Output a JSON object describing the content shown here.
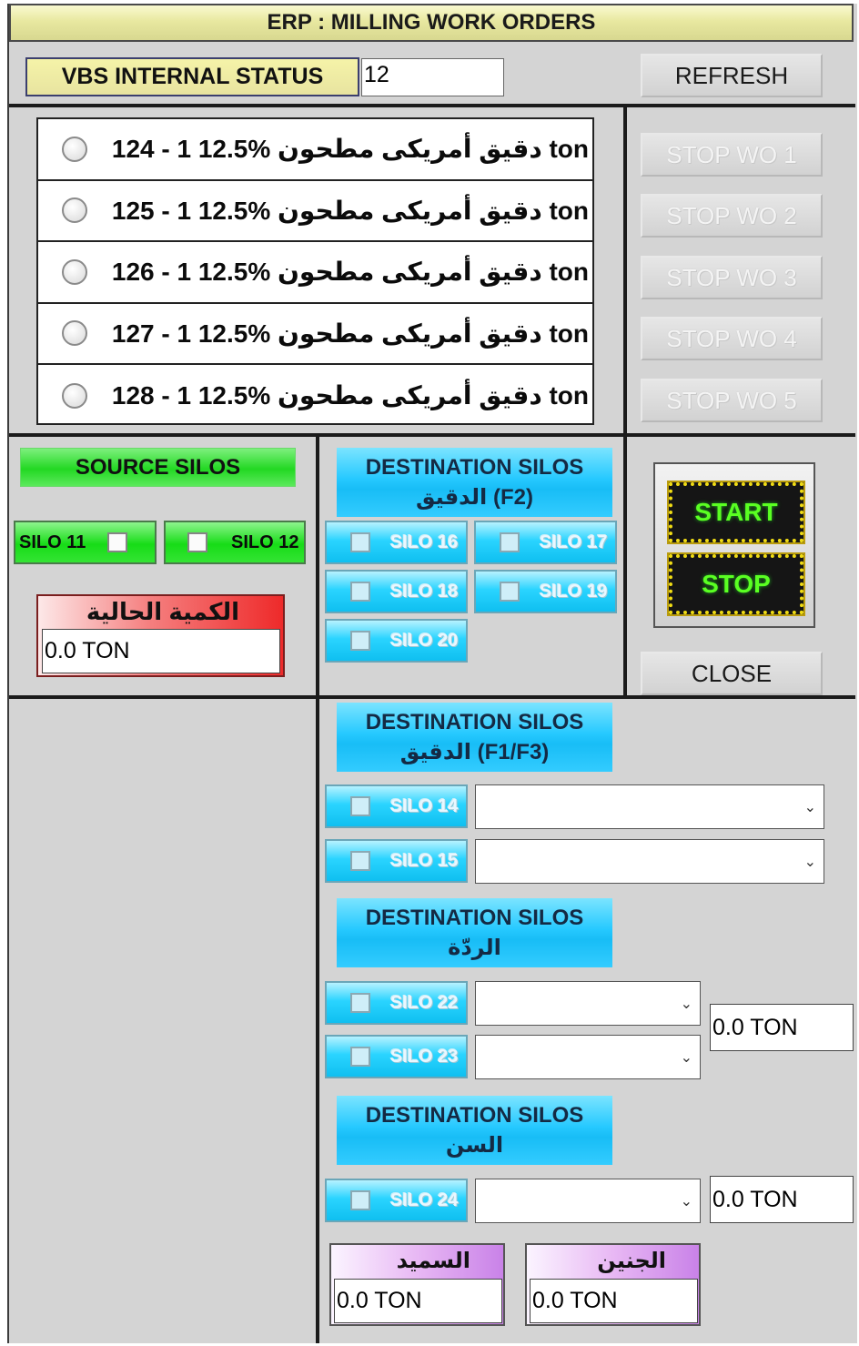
{
  "window": {
    "title": "ERP : MILLING WORK ORDERS"
  },
  "status": {
    "label": "VBS INTERNAL STATUS",
    "value": "12"
  },
  "buttons": {
    "refresh": "REFRESH",
    "close": "CLOSE",
    "start": "START",
    "stop": "STOP",
    "stop_wo": [
      "STOP WO 1",
      "STOP WO 2",
      "STOP WO 3",
      "STOP WO 4",
      "STOP WO 5"
    ]
  },
  "work_orders": [
    "124 - 1 12.5% دقيق أمريكى مطحون ton",
    "125 - 1 12.5% دقيق أمريكى مطحون ton",
    "126 - 1 12.5% دقيق أمريكى مطحون ton",
    "127 - 1 12.5% دقيق أمريكى مطحون ton",
    "128 - 1 12.5% دقيق أمريكى مطحون ton"
  ],
  "source": {
    "header": "SOURCE SILOS",
    "silos": [
      "SILO 11",
      "SILO 12"
    ],
    "current_qty_label": "الكمية الحالية",
    "current_qty": "0.0  TON"
  },
  "dest_f2": {
    "header": "DESTINATION SILOS",
    "sub": "الدقيق (F2)",
    "silos": [
      "SILO 16",
      "SILO 17",
      "SILO 18",
      "SILO 19",
      "SILO 20"
    ]
  },
  "dest_f1f3": {
    "header": "DESTINATION SILOS",
    "sub": "الدقيق (F1/F3)",
    "silos": [
      "SILO 14",
      "SILO 15"
    ]
  },
  "dest_bran": {
    "header": "DESTINATION SILOS",
    "sub": "الردّة",
    "silos": [
      "SILO 22",
      "SILO 23"
    ],
    "qty": "0.0  TON"
  },
  "dest_sen": {
    "header": "DESTINATION SILOS",
    "sub": "السن",
    "silos": [
      "SILO 24"
    ],
    "qty": "0.0  TON"
  },
  "semolina": {
    "label": "السميد",
    "qty": "0.0  TON"
  },
  "germ": {
    "label": "الجنين",
    "qty": "0.0  TON"
  },
  "colors": {
    "title_bg": "#e8e8a0",
    "source_green": "#23d823",
    "dest_cyan": "#18bdf6",
    "qty_red": "#ee2a2a",
    "led_green": "#5aff22",
    "purple": "#c982e8"
  }
}
